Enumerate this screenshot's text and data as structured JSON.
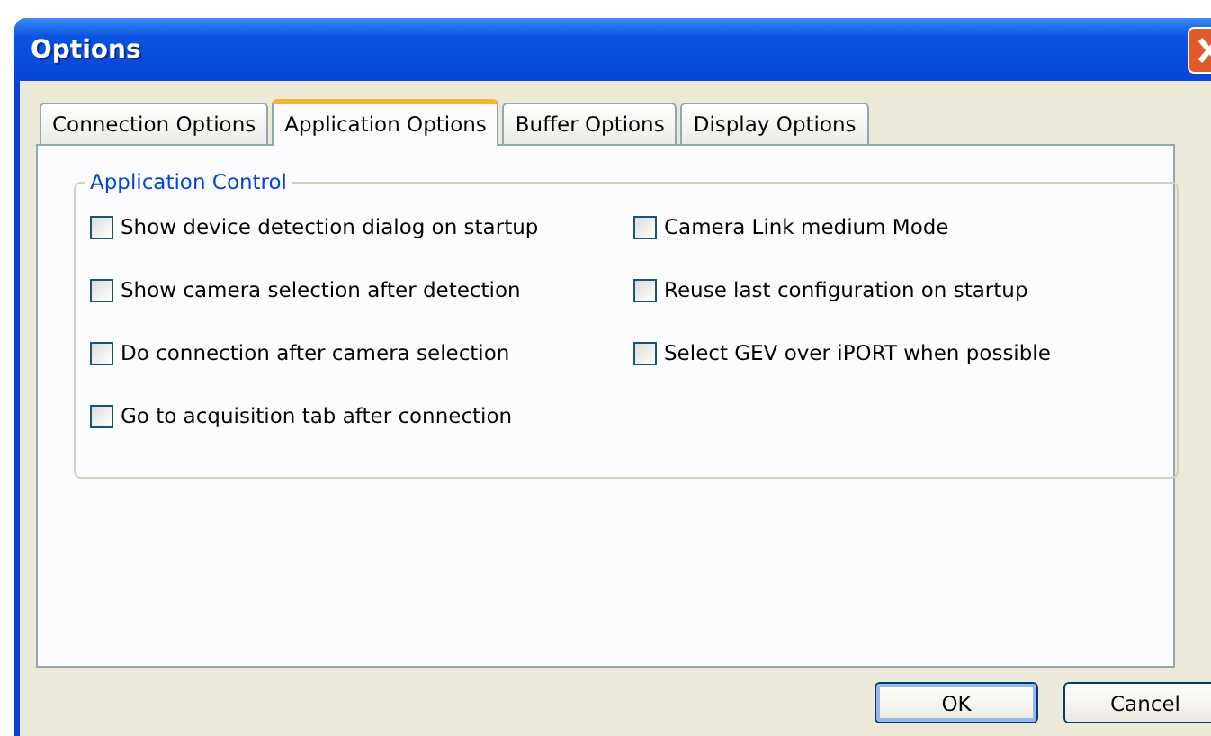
{
  "window": {
    "title": "Options"
  },
  "tabs": [
    {
      "label": "Connection Options",
      "selected": false
    },
    {
      "label": "Application Options",
      "selected": true
    },
    {
      "label": "Buffer Options",
      "selected": false
    },
    {
      "label": "Display Options",
      "selected": false
    }
  ],
  "group": {
    "title": "Application Control",
    "left": [
      {
        "label": "Show device detection dialog on startup",
        "checked": false
      },
      {
        "label": "Show camera selection after detection",
        "checked": false
      },
      {
        "label": "Do connection after camera selection",
        "checked": false
      },
      {
        "label": "Go to acquisition tab after connection",
        "checked": false
      }
    ],
    "right": [
      {
        "label": "Camera Link medium Mode",
        "checked": false
      },
      {
        "label": "Reuse last configuration on startup",
        "checked": false
      },
      {
        "label": "Select GEV over iPORT when possible",
        "checked": false
      }
    ]
  },
  "buttons": [
    {
      "label": "OK",
      "default": true
    },
    {
      "label": "Cancel",
      "default": false
    }
  ]
}
